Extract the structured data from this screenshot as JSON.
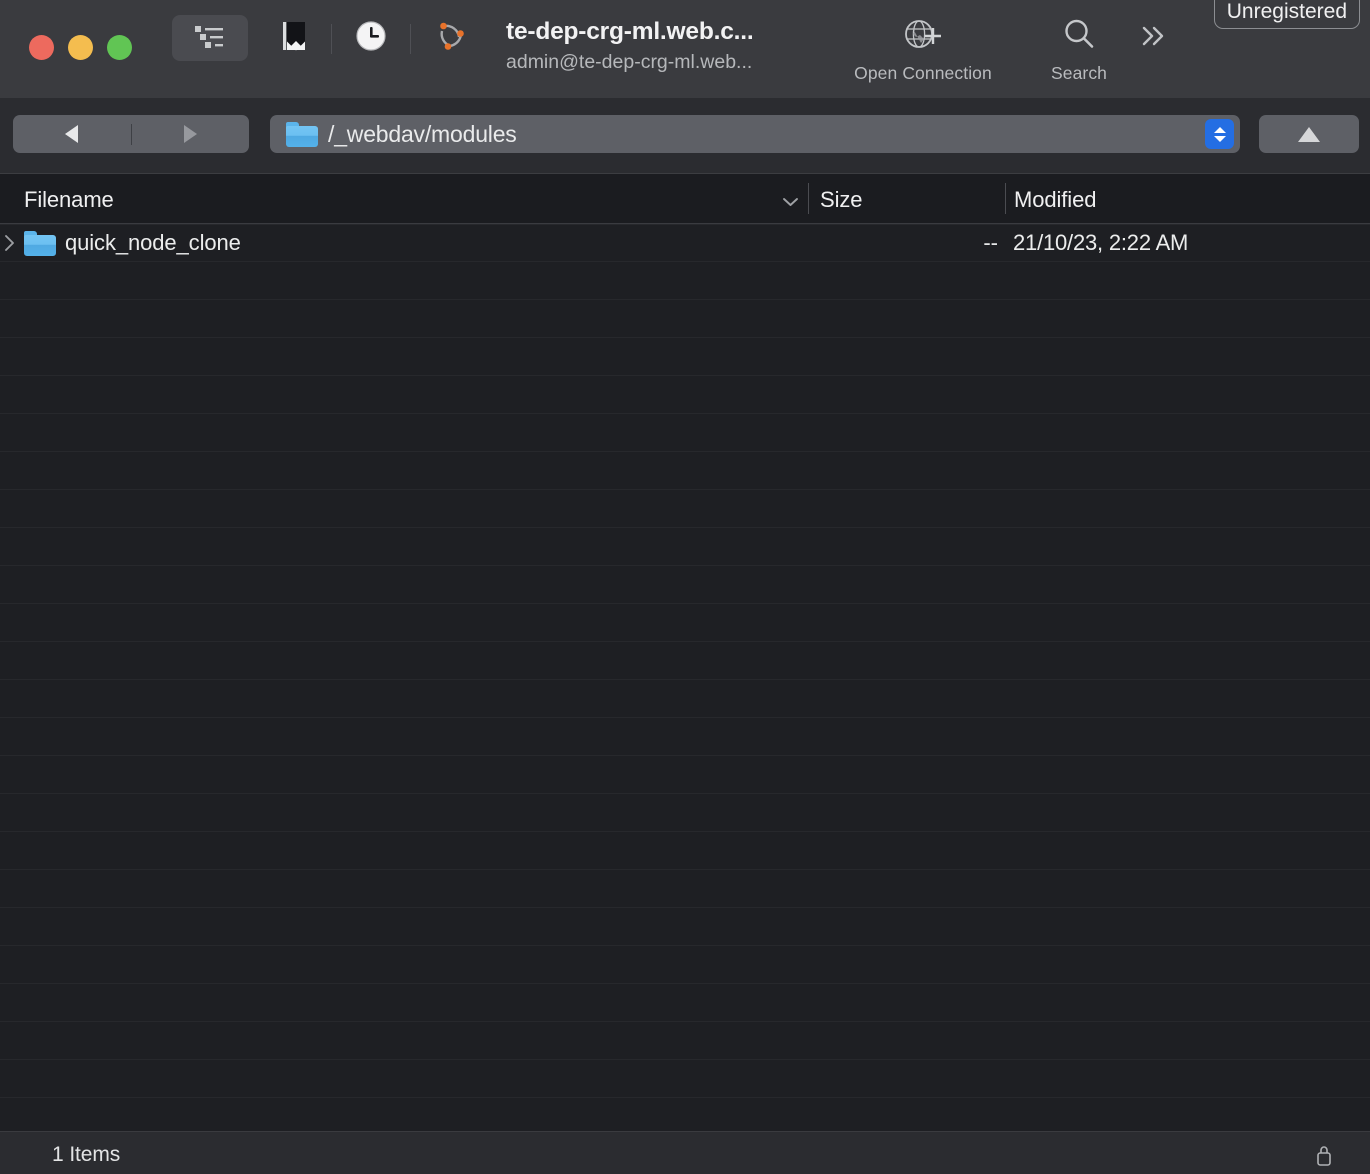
{
  "window": {
    "title": "te-dep-crg-ml.web.c...",
    "subtitle": "admin@te-dep-crg-ml.web...",
    "badge": "Unregistered"
  },
  "traffic_lights": {
    "close": "close-button",
    "minimize": "minimize-button",
    "maximize": "maximize-button",
    "close_color": "#ed6a5e",
    "minimize_color": "#f4bd4f",
    "maximize_color": "#61c554"
  },
  "toolbar": {
    "items": [
      {
        "name": "browser-view-icon",
        "label": ""
      },
      {
        "name": "bookmarks-icon",
        "label": ""
      },
      {
        "name": "history-clock-icon",
        "label": ""
      },
      {
        "name": "bonjour-network-icon",
        "label": ""
      }
    ],
    "open_connection_label": "Open Connection",
    "open_connection_icon": "globe-plus-icon",
    "search_label": "Search",
    "search_icon": "search-icon",
    "overflow_icon": "chevron-double-right-icon"
  },
  "navbar": {
    "back_icon": "triangle-left-icon",
    "forward_icon": "triangle-right-icon",
    "path_icon": "folder-icon",
    "path_value": "/_webdav/modules",
    "stepper_icon": "stepper-up-down-icon",
    "up_icon": "triangle-up-icon",
    "stepper_color": "#246ee3"
  },
  "columns": [
    {
      "key": "filename",
      "label": "Filename",
      "sort_indicator": "chevron-down-icon"
    },
    {
      "key": "size",
      "label": "Size"
    },
    {
      "key": "modified",
      "label": "Modified"
    }
  ],
  "files": [
    {
      "name": "quick_node_clone",
      "size": "--",
      "modified": "21/10/23, 2:22 AM",
      "icon": "folder-icon",
      "disclosure": "chevron-right-icon"
    }
  ],
  "empty_row_count": 23,
  "statusbar": {
    "items_text": "1 Items",
    "lock_icon": "padlock-icon"
  }
}
